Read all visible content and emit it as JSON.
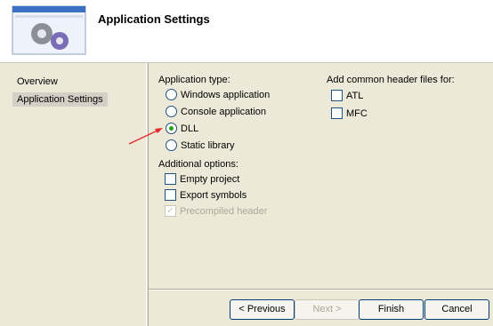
{
  "header": {
    "title": "Application Settings"
  },
  "nav": {
    "items": [
      "Overview",
      "Application Settings"
    ]
  },
  "app_type": {
    "label": "Application type:",
    "options": [
      "Windows application",
      "Console application",
      "DLL",
      "Static library"
    ],
    "selected": "DLL"
  },
  "additional": {
    "label": "Additional options:",
    "options": [
      {
        "label": "Empty project",
        "checked": false,
        "disabled": false
      },
      {
        "label": "Export symbols",
        "checked": false,
        "disabled": false
      },
      {
        "label": "Precompiled header",
        "checked": true,
        "disabled": true
      }
    ]
  },
  "common_headers": {
    "label": "Add common header files for:",
    "options": [
      "ATL",
      "MFC"
    ]
  },
  "buttons": {
    "previous": "< Previous",
    "next": "Next >",
    "finish": "Finish",
    "cancel": "Cancel"
  },
  "colors": {
    "annotation_arrow": "#e8262b",
    "radio_dot": "#21a121"
  }
}
